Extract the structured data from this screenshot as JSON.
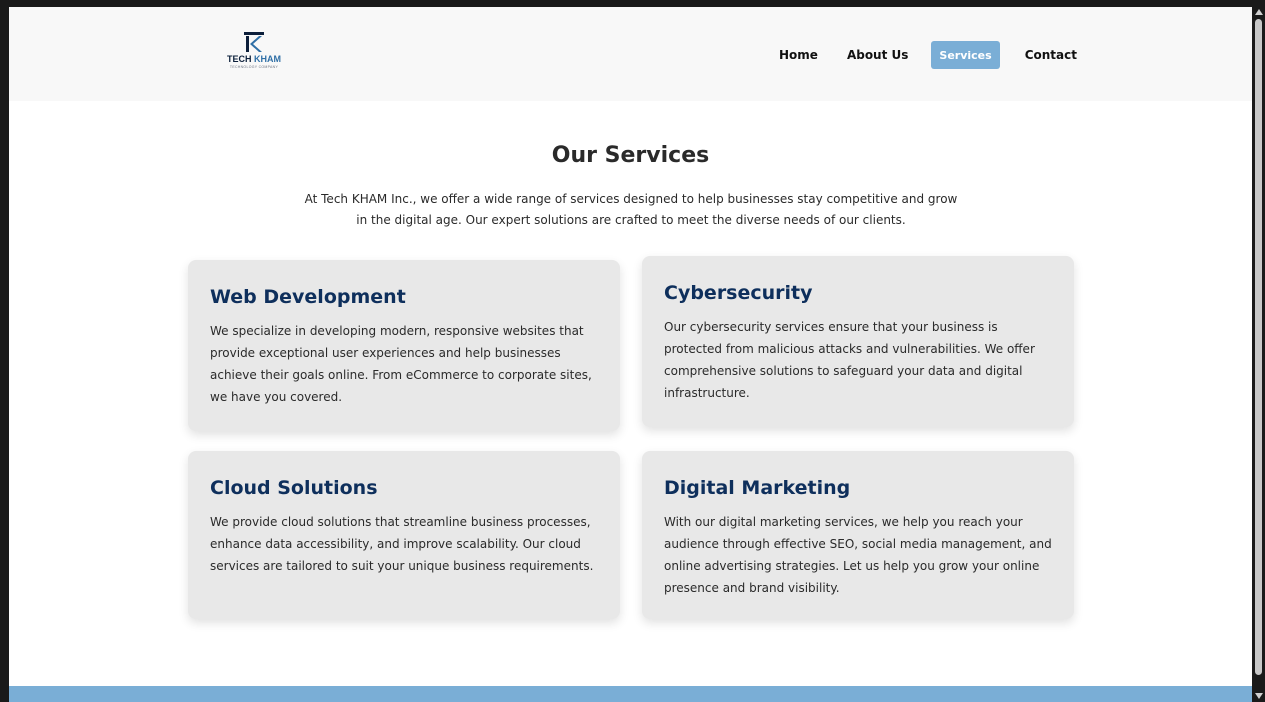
{
  "logo": {
    "text_main": "TECH",
    "text_accent": "KHAM",
    "tagline": "TECHNOLOGY COMPANY"
  },
  "nav": {
    "home": "Home",
    "about": "About Us",
    "services": "Services",
    "contact": "Contact",
    "active": "services"
  },
  "main": {
    "title": "Our Services",
    "intro": "At Tech KHAM Inc., we offer a wide range of services designed to help businesses stay competitive and grow in the digital age. Our expert solutions are crafted to meet the diverse needs of our clients."
  },
  "services": [
    {
      "title": "Web Development",
      "text": "We specialize in developing modern, responsive websites that provide exceptional user experiences and help businesses achieve their goals online. From eCommerce to corporate sites, we have you covered."
    },
    {
      "title": "Cybersecurity",
      "text": "Our cybersecurity services ensure that your business is protected from malicious attacks and vulnerabilities. We offer comprehensive solutions to safeguard your data and digital infrastructure."
    },
    {
      "title": "Cloud Solutions",
      "text": "We provide cloud solutions that streamline business processes, enhance data accessibility, and improve scalability. Our cloud services are tailored to suit your unique business requirements."
    },
    {
      "title": "Digital Marketing",
      "text": "With our digital marketing services, we help you reach your audience through effective SEO, social media management, and online advertising strategies. Let us help you grow your online presence and brand visibility."
    }
  ],
  "colors": {
    "accent": "#7aaed6",
    "heading": "#0e2f5c",
    "card_bg": "#e8e8e8"
  }
}
